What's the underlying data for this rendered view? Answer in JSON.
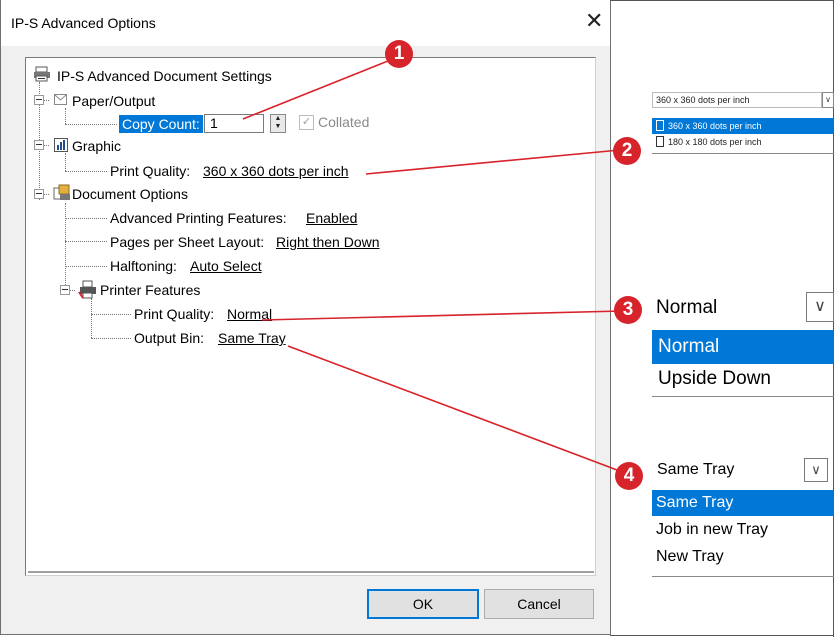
{
  "dialog": {
    "title": "IP-S Advanced Options",
    "close_glyph": "✕",
    "ok_label": "OK",
    "cancel_label": "Cancel"
  },
  "tree": {
    "root": "IP-S Advanced Document Settings",
    "paper_output": "Paper/Output",
    "copy_count_label": "Copy Count:",
    "copy_count_value": "1",
    "collated_label": "Collated",
    "graphic": "Graphic",
    "print_quality_label": "Print Quality:",
    "print_quality_value": "360 x 360 dots per inch",
    "document_options": "Document Options",
    "adv_features_label": "Advanced Printing Features:",
    "adv_features_value": "Enabled",
    "pages_layout_label": "Pages per Sheet Layout:",
    "pages_layout_value": "Right then Down",
    "halftoning_label": "Halftoning:",
    "halftoning_value": "Auto Select",
    "printer_features": "Printer Features",
    "pf_quality_label": "Print Quality:",
    "pf_quality_value": "Normal",
    "output_bin_label": "Output Bin:",
    "output_bin_value": "Same Tray"
  },
  "callouts": {
    "n1": "1",
    "n2": "2",
    "n3": "3",
    "n4": "4",
    "color": "#d7232a"
  },
  "panel_resolution": {
    "selected": "360 x 360 dots per inch",
    "options": [
      "360 x 360 dots per inch",
      "180 x 180 dots per inch"
    ],
    "highlight_index": 0
  },
  "panel_quality": {
    "selected": "Normal",
    "options": [
      "Normal",
      "Upside Down"
    ],
    "highlight_index": 0
  },
  "panel_tray": {
    "selected": "Same Tray",
    "options": [
      "Same Tray",
      "Job in new Tray",
      "New Tray"
    ],
    "highlight_index": 0
  },
  "colors": {
    "accent": "#0078d7",
    "callout_red": "#d7232a"
  },
  "icons": [
    "printer-icon",
    "paper-icon",
    "graphic-icon",
    "document-options-icon",
    "printer-features-icon",
    "spin-arrows-icon",
    "checkbox-icon",
    "chevron-down-icon",
    "resolution-icon"
  ]
}
